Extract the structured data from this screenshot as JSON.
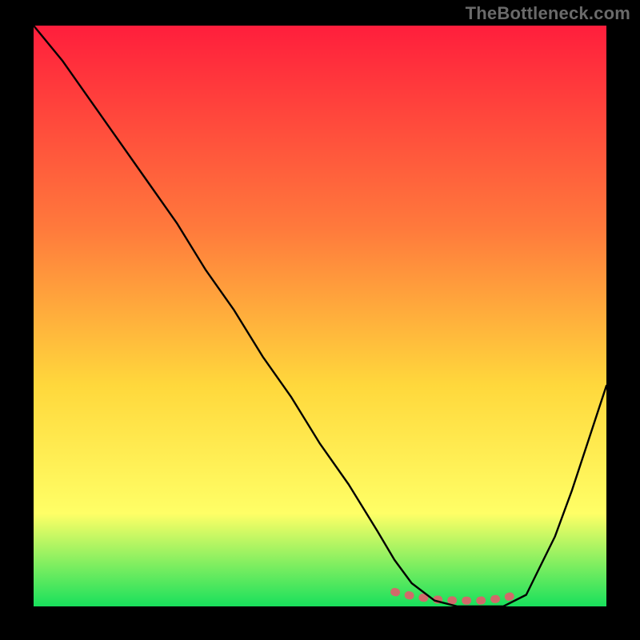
{
  "watermark": "TheBottleneck.com",
  "chart_data": {
    "type": "line",
    "title": "",
    "xlabel": "",
    "ylabel": "",
    "xlim": [
      0,
      100
    ],
    "ylim": [
      0,
      100
    ],
    "series": [
      {
        "name": "bottleneck-curve",
        "x": [
          0,
          5,
          10,
          15,
          20,
          25,
          30,
          35,
          40,
          45,
          50,
          55,
          60,
          63,
          66,
          70,
          74,
          78,
          82,
          86,
          88,
          91,
          94,
          97,
          100
        ],
        "y": [
          100,
          94,
          87,
          80,
          73,
          66,
          58,
          51,
          43,
          36,
          28,
          21,
          13,
          8,
          4,
          1,
          0,
          0,
          0,
          2,
          6,
          12,
          20,
          29,
          38
        ],
        "estimated": true
      },
      {
        "name": "flat-minimum-highlight",
        "x": [
          63,
          66,
          70,
          74,
          78,
          82,
          85
        ],
        "y": [
          2.5,
          1.8,
          1.2,
          1.0,
          1.0,
          1.4,
          2.2
        ],
        "estimated": true
      }
    ],
    "colors": {
      "curve": "#000000",
      "highlight": "#d16a6a",
      "gradient_top": "#ff1e3c",
      "gradient_mid1": "#ff7a3c",
      "gradient_mid2": "#ffd83c",
      "gradient_mid3": "#ffff66",
      "gradient_bottom": "#18e05c"
    }
  }
}
